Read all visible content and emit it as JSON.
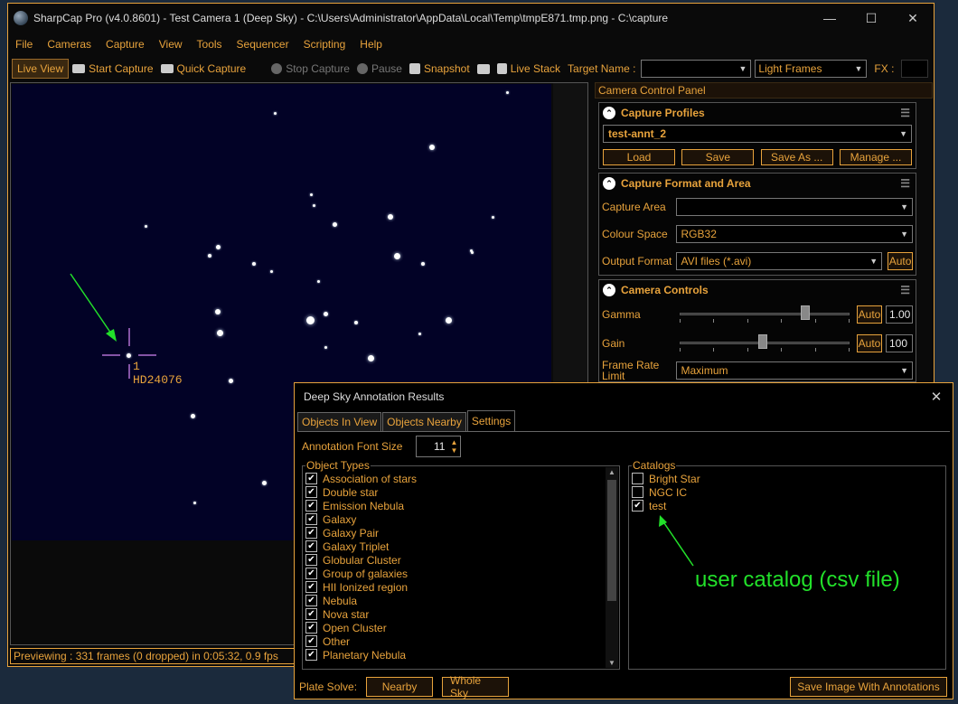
{
  "window": {
    "title": "SharpCap Pro (v4.0.8601) - Test Camera 1 (Deep Sky) - C:\\Users\\Administrator\\AppData\\Local\\Temp\\tmpE871.tmp.png - C:\\capture",
    "minimize": "—",
    "maximize": "☐",
    "close": "✕"
  },
  "menu": [
    "File",
    "Cameras",
    "Capture",
    "View",
    "Tools",
    "Sequencer",
    "Scripting",
    "Help"
  ],
  "toolbar": {
    "live_view": "Live View",
    "start_capture": "Start Capture",
    "quick_capture": "Quick Capture",
    "stop_capture": "Stop Capture",
    "pause": "Pause",
    "snapshot": "Snapshot",
    "live_stack": "Live Stack",
    "target_name_label": "Target Name :",
    "target_name_value": "",
    "frame_type": "Light Frames",
    "fx_label": "FX :"
  },
  "viewer": {
    "marker_index": "1",
    "marker_name": "HD24076"
  },
  "status": {
    "text": "Previewing : 331 frames (0 dropped) in 0:05:32, 0.9 fps"
  },
  "panel": {
    "title": "Camera Control Panel",
    "capture_profiles": {
      "title": "Capture Profiles",
      "selected": "test-annt_2",
      "buttons": [
        "Load",
        "Save",
        "Save As ...",
        "Manage ..."
      ]
    },
    "capture_format": {
      "title": "Capture Format and Area",
      "capture_area_label": "Capture Area",
      "capture_area_value": "",
      "colour_space_label": "Colour Space",
      "colour_space_value": "RGB32",
      "output_format_label": "Output Format",
      "output_format_value": "AVI files (*.avi)",
      "auto": "Auto"
    },
    "camera_controls": {
      "title": "Camera Controls",
      "gamma_label": "Gamma",
      "gamma_auto": "Auto",
      "gamma_value": "1.00",
      "gamma_level": 0.75,
      "gain_label": "Gain",
      "gain_auto": "Auto",
      "gain_value": "100",
      "gain_level": 0.49,
      "frame_rate_label": "Frame Rate Limit",
      "frame_rate_value": "Maximum"
    }
  },
  "dialog": {
    "title": "Deep Sky Annotation Results",
    "close": "✕",
    "tabs": [
      "Objects In View",
      "Objects Nearby",
      "Settings"
    ],
    "font_size_label": "Annotation Font Size",
    "font_size_value": "11",
    "object_types_legend": "Object Types",
    "object_types": [
      "Association of stars",
      "Double star",
      "Emission Nebula",
      "Galaxy",
      "Galaxy Pair",
      "Galaxy Triplet",
      "Globular Cluster",
      "Group of galaxies",
      "HII Ionized region",
      "Nebula",
      "Nova star",
      "Open Cluster",
      "Other",
      "Planetary Nebula"
    ],
    "catalogs_legend": "Catalogs",
    "catalogs": [
      {
        "label": "Bright Star",
        "checked": false
      },
      {
        "label": "NGC IC",
        "checked": false
      },
      {
        "label": "test",
        "checked": true
      }
    ],
    "plate_solve_label": "Plate Solve:",
    "nearby": "Nearby",
    "whole_sky": "Whole Sky",
    "save_image": "Save Image With Annotations"
  },
  "annotation": {
    "text": "user catalog (csv file)",
    "color": "#22e02a"
  },
  "colors": {
    "accent": "#e8a33c",
    "sky": "#020226",
    "marker": "#b070d0"
  }
}
